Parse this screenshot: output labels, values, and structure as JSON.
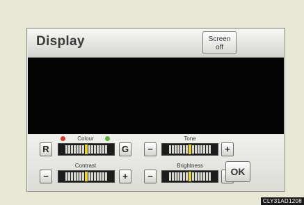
{
  "header": {
    "title": "Display",
    "screen_off_line1": "Screen",
    "screen_off_line2": "off"
  },
  "controls": {
    "colour": {
      "label": "Colour",
      "left": "R",
      "right": "G",
      "level": 0.5
    },
    "tone": {
      "label": "Tone",
      "left": "−",
      "right": "+",
      "level": 0.5
    },
    "contrast": {
      "label": "Contrast",
      "left": "−",
      "right": "+",
      "level": 0.5
    },
    "brightness": {
      "label": "Brightness",
      "left": "−",
      "right": "+",
      "level": 0.5
    }
  },
  "ok_label": "OK",
  "image_code": "CLY31AD1208",
  "colors": {
    "red_dot": "#d93a2a",
    "green_dot": "#5aae3a",
    "center_marker": "#e9d62a"
  }
}
